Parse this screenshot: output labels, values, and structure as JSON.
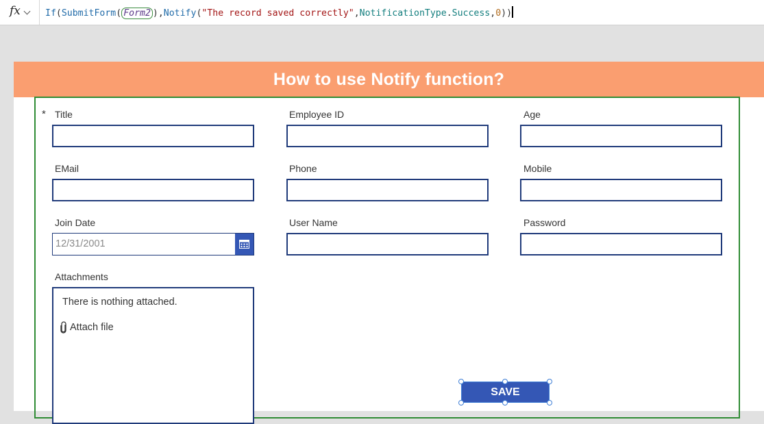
{
  "formula_bar": {
    "fx_label": "fx",
    "tokens": {
      "if": "If",
      "p1": "(",
      "submit": "SubmitForm",
      "p2": "(",
      "form_ref": "Form2",
      "p3": "),",
      "notify": "Notify",
      "p4": "(",
      "message": "\"The record saved correctly\"",
      "p5": ",",
      "ntype": "NotificationType",
      "p6": ".",
      "success": "Success",
      "p7": ",",
      "timeout": "0",
      "p8": "))"
    }
  },
  "header": {
    "title": "How to use Notify function?"
  },
  "form": {
    "title_required_mark": "*",
    "fields": {
      "title": {
        "label": "Title",
        "value": ""
      },
      "employee_id": {
        "label": "Employee ID",
        "value": ""
      },
      "age": {
        "label": "Age",
        "value": ""
      },
      "email": {
        "label": "EMail",
        "value": ""
      },
      "phone": {
        "label": "Phone",
        "value": ""
      },
      "mobile": {
        "label": "Mobile",
        "value": ""
      },
      "join_date": {
        "label": "Join Date",
        "value": "12/31/2001"
      },
      "user_name": {
        "label": "User Name",
        "value": ""
      },
      "password": {
        "label": "Password",
        "value": ""
      },
      "attachments": {
        "label": "Attachments",
        "empty_text": "There is nothing attached.",
        "attach_label": "Attach file"
      }
    },
    "save_label": "SAVE"
  },
  "colors": {
    "header_bg": "#fa9e70",
    "form_border": "#2e8b33",
    "input_border": "#1f3a7a",
    "button_bg": "#3457b5",
    "selection": "#3f7fd6"
  }
}
